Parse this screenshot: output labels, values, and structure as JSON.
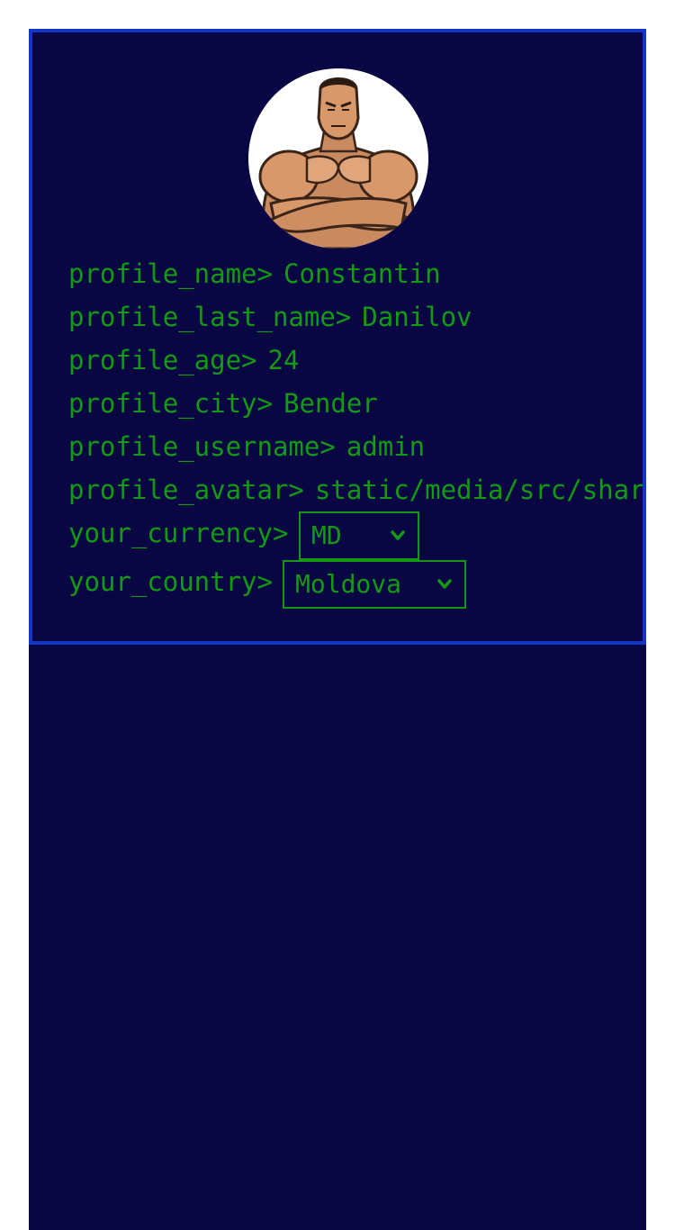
{
  "profile": {
    "fields": [
      {
        "label": "profile_name>",
        "value": "Constantin"
      },
      {
        "label": "profile_last_name>",
        "value": "Danilov"
      },
      {
        "label": "profile_age>",
        "value": "24"
      },
      {
        "label": "profile_city>",
        "value": "Bender"
      },
      {
        "label": "profile_username>",
        "value": "admin"
      },
      {
        "label": "profile_avatar>",
        "value": "static/media/src/shared"
      }
    ],
    "currency": {
      "label": "your_currency>",
      "selected": "MD"
    },
    "country": {
      "label": "your_country>",
      "selected": "Moldova"
    }
  },
  "colors": {
    "background": "#0a0644",
    "border": "#1535c7",
    "text": "#129a12"
  },
  "icons": {
    "avatar": "bodybuilder-avatar-icon",
    "select_arrow": "chevron-down-icon"
  }
}
